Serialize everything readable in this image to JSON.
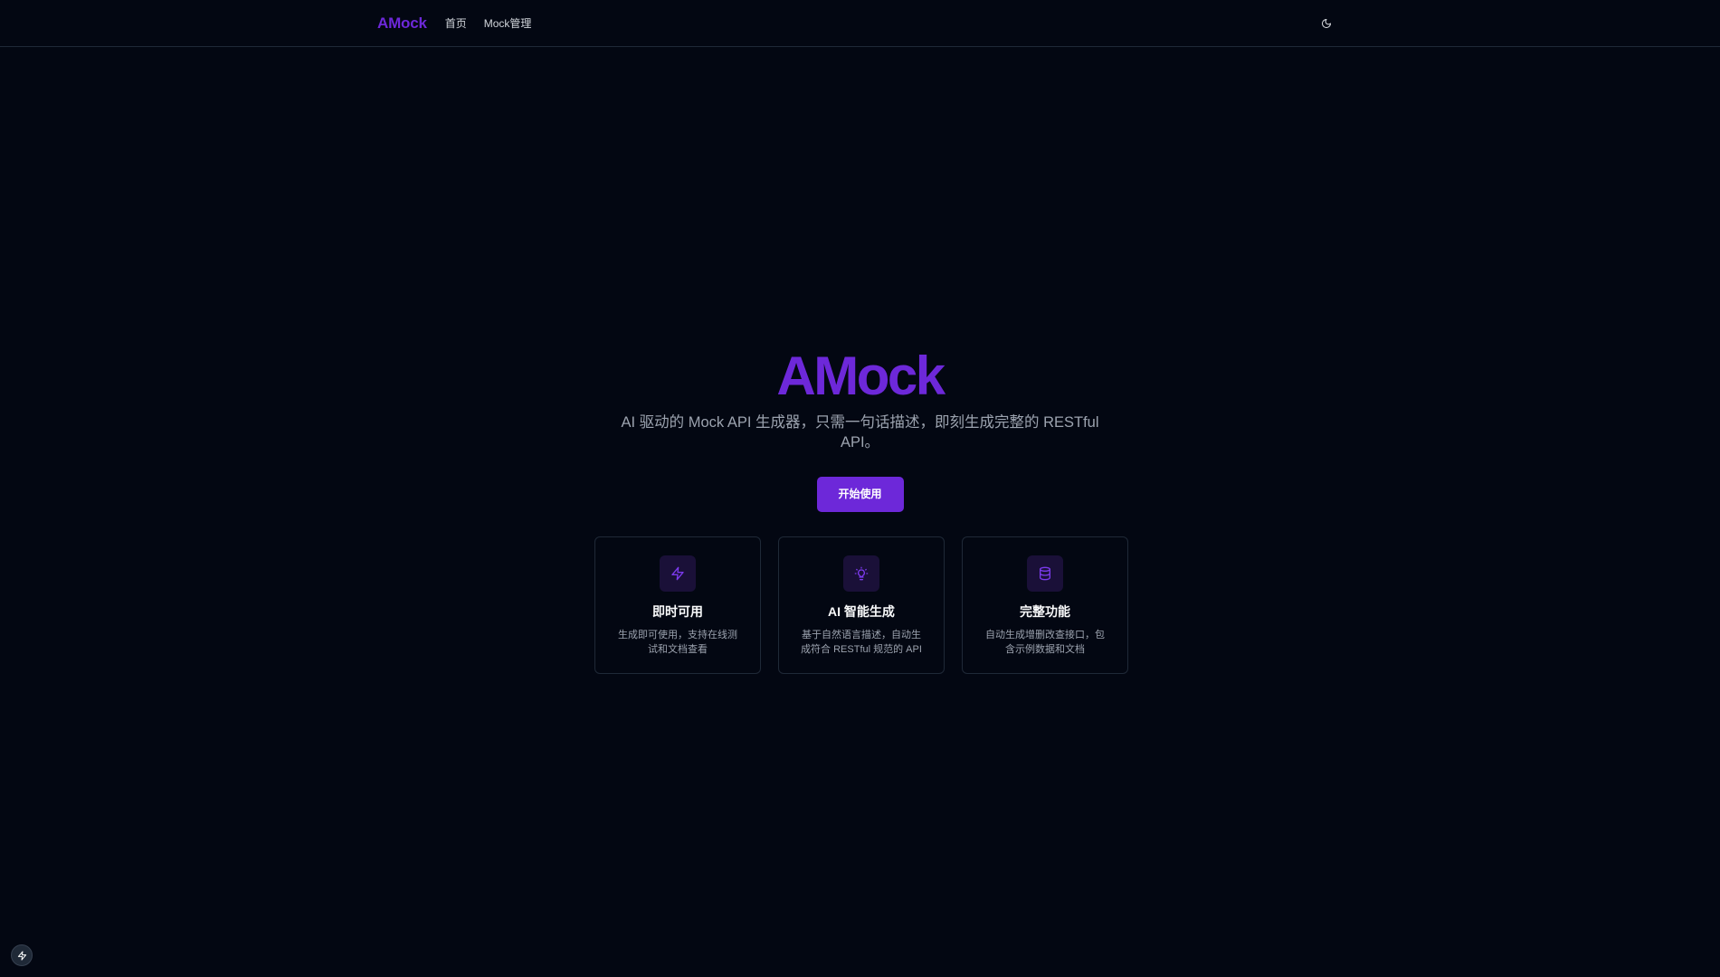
{
  "nav": {
    "brand": "AMock",
    "links": [
      {
        "label": "首页"
      },
      {
        "label": "Mock管理"
      }
    ],
    "theme_icon": "moon-icon"
  },
  "hero": {
    "title": "AMock",
    "description": "AI 驱动的 Mock API 生成器，只需一句话描述，即刻生成完整的 RESTful API。",
    "cta_label": "开始使用"
  },
  "features": [
    {
      "icon": "lightning-icon",
      "title": "即时可用",
      "desc": "生成即可使用，支持在线测试和文档查看"
    },
    {
      "icon": "lightbulb-icon",
      "title": "AI 智能生成",
      "desc": "基于自然语言描述，自动生成符合 RESTful 规范的 API"
    },
    {
      "icon": "database-icon",
      "title": "完整功能",
      "desc": "自动生成增删改查接口，包含示例数据和文档"
    }
  ],
  "dev_badge_icon": "lightning-icon",
  "colors": {
    "background": "#030712",
    "accent": "#6d28d9",
    "border": "#1f2937",
    "muted_text": "#9ca3af"
  }
}
